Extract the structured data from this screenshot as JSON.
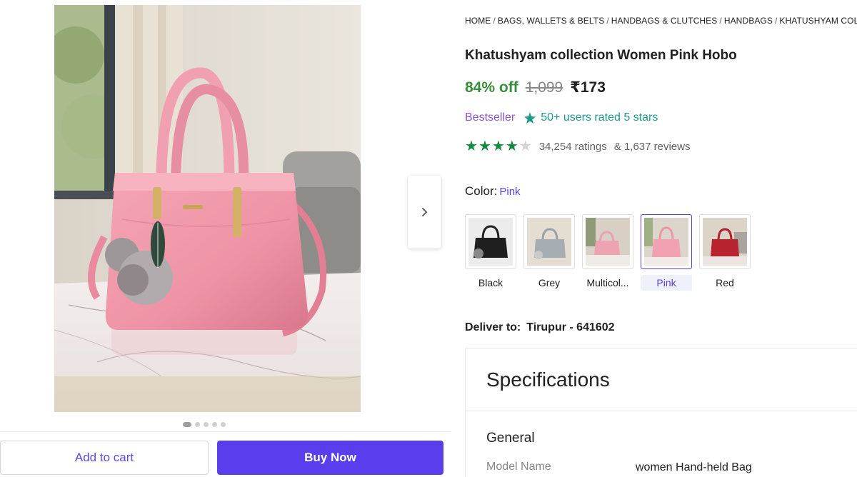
{
  "breadcrumb": [
    "HOME",
    "BAGS, WALLETS & BELTS",
    "HANDBAGS & CLUTCHES",
    "HANDBAGS",
    "KHATUSHYAM COLLECTION HANDBAGS"
  ],
  "product": {
    "title": "Khatushyam collection Women Pink Hobo",
    "discount": "84% off",
    "mrp": "1,099",
    "price": "₹173",
    "bestseller": "Bestseller",
    "rated_text": "50+ users rated 5 stars",
    "rating_value": 4,
    "rating_max": 5,
    "ratings_count": "34,254 ratings",
    "reviews_count": "& 1,637 reviews"
  },
  "color": {
    "label": "Color:",
    "selected": "Pink",
    "options": [
      {
        "name": "Black"
      },
      {
        "name": "Grey"
      },
      {
        "name": "Multicol..."
      },
      {
        "name": "Pink"
      },
      {
        "name": "Red"
      }
    ]
  },
  "delivery": {
    "label": "Deliver to:",
    "location": "Tirupur - 641602"
  },
  "specifications": {
    "title": "Specifications",
    "group": "General",
    "rows": [
      {
        "key": "Model Name",
        "value": "women Hand-held Bag"
      }
    ]
  },
  "gallery": {
    "image_count": 5,
    "active_index": 0
  },
  "actions": {
    "add_to_cart": "Add to cart",
    "buy_now": "Buy Now"
  },
  "colors": {
    "accent": "#5a3ded",
    "discount_green": "#388e3c",
    "star_green": "#138a3d",
    "bestseller_purple": "#8a55c8",
    "rated_teal": "#1d9a8a"
  }
}
